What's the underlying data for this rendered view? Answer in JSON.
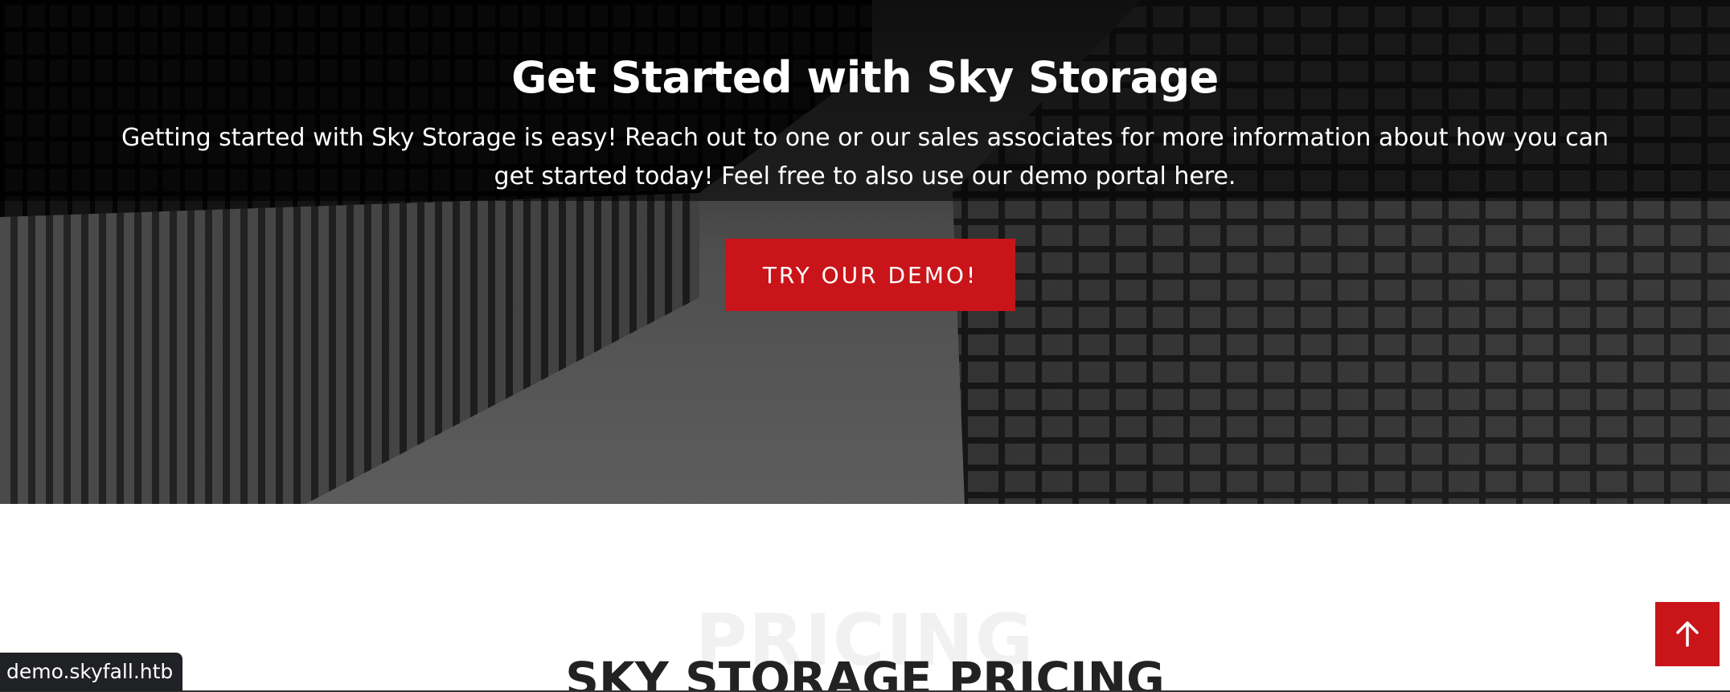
{
  "hero": {
    "title": "Get Started with Sky Storage",
    "text": "Getting started with Sky Storage is easy! Reach out to one or our sales associates for more information about how you can get started today! Feel free to also use our demo portal here.",
    "button_label": "TRY OUR DEMO!"
  },
  "pricing": {
    "watermark": "PRICING",
    "title": "SKY STORAGE PRICING"
  },
  "status_bar": {
    "url": "demo.skyfall.htb"
  },
  "back_to_top": {
    "icon": "arrow-up-icon"
  },
  "colors": {
    "accent": "#c9151a",
    "heading": "#222222",
    "status_bg": "#202124"
  }
}
